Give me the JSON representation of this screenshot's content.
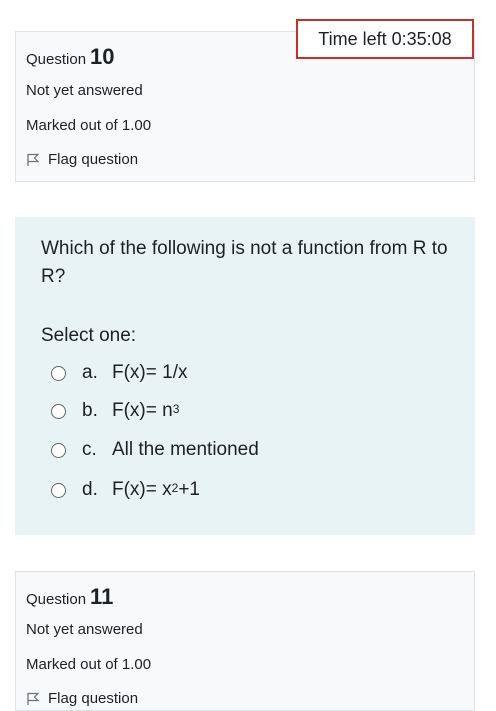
{
  "timer": {
    "label": "Time left 0:35:08"
  },
  "q10": {
    "question_word": "Question",
    "number": "10",
    "status": "Not yet answered",
    "marks": "Marked out of 1.00",
    "flag_label": "Flag question"
  },
  "question": {
    "text": "Which of the following is not a function from R to R?",
    "prompt": "Select one:",
    "options": [
      {
        "letter": "a.",
        "text": "F(x)= 1/x"
      },
      {
        "letter": "b.",
        "text": "F(x)= n",
        "sup": "3"
      },
      {
        "letter": "c.",
        "text": "All the mentioned"
      },
      {
        "letter": "d.",
        "text": "F(x)= x",
        "sup": "2",
        "suffix": "+1"
      }
    ]
  },
  "q11": {
    "question_word": "Question",
    "number": "11",
    "status": "Not yet answered",
    "marks": "Marked out of 1.00",
    "flag_label": "Flag question"
  },
  "colors": {
    "timer_border": "#c9302c",
    "content_bg": "#e7f3f5",
    "info_bg": "#f8f9fa"
  }
}
